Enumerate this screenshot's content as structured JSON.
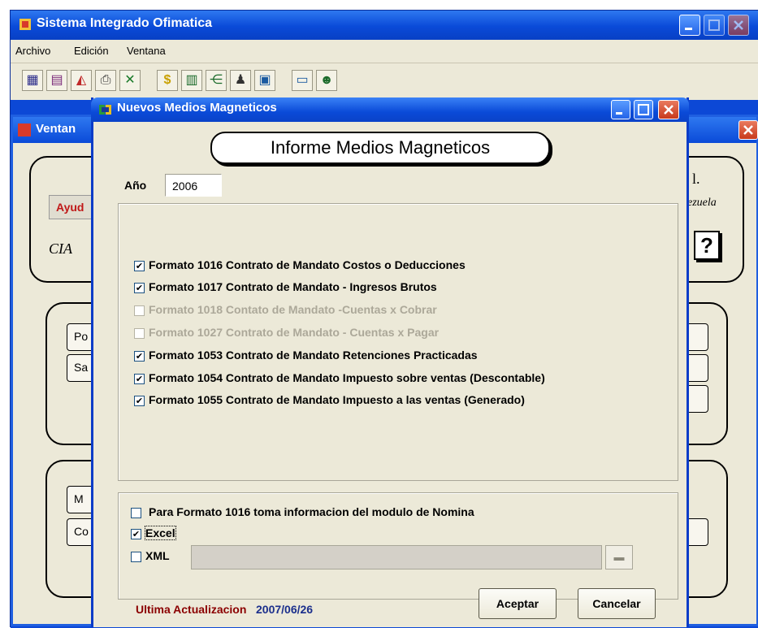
{
  "app": {
    "title": "Sistema Integrado Ofimatica",
    "menu": [
      "Archivo",
      "Edición",
      "Ventana"
    ]
  },
  "toolbar_icons": [
    "calculator-icon",
    "book-icon",
    "chart-icon",
    "printer-icon",
    "excel-icon",
    "dollar-icon",
    "grid-icon",
    "tree-icon",
    "people-icon",
    "window-icon",
    "monitors-icon",
    "user-icon"
  ],
  "background_window": {
    "title": "Ventan",
    "help_label": "Ayud",
    "cia_label": "CIA",
    "right_text_1": "l.",
    "right_text_2": "ezuela",
    "buttons": [
      "Po",
      "Sa",
      "M",
      "Co"
    ]
  },
  "dialog": {
    "title": "Nuevos Medios Magneticos",
    "heading": "Informe Medios Magneticos",
    "year_label": "Año",
    "year_value": "2006",
    "formats": [
      {
        "label": "Formato 1016 Contrato de Mandato Costos o Deducciones",
        "checked": true,
        "enabled": true
      },
      {
        "label": "Formato 1017  Contrato de Mandato - Ingresos Brutos",
        "checked": true,
        "enabled": true
      },
      {
        "label": "Formato 1018 Contato de Mandato -Cuentas x Cobrar",
        "checked": false,
        "enabled": false
      },
      {
        "label": "Formato 1027 Contrato de Mandato - Cuentas x Pagar",
        "checked": false,
        "enabled": false
      },
      {
        "label": "Formato 1053 Contrato de Mandato Retenciones Practicadas",
        "checked": true,
        "enabled": true
      },
      {
        "label": "Formato 1054 Contrato de Mandato Impuesto sobre ventas (Descontable)",
        "checked": true,
        "enabled": true
      },
      {
        "label": "Formato 1055 Contrato de Mandato Impuesto a las ventas (Generado)",
        "checked": true,
        "enabled": true
      }
    ],
    "options": {
      "nomina_label": "Para Formato 1016 toma informacion del modulo de Nomina",
      "nomina_checked": false,
      "excel_label": "Excel",
      "excel_checked": true,
      "xml_label": "XML",
      "xml_checked": false,
      "xml_path": ""
    },
    "updated_label": "Ultima Actualizacion",
    "updated_value": "2007/06/26",
    "accept_label": "Aceptar",
    "cancel_label": "Cancelar"
  },
  "colors": {
    "titlebar_blue": "#0a4ad8",
    "window_face": "#ece9d8",
    "updated_label_red": "#8b0000",
    "updated_value_blue": "#1b2f8c",
    "disabled_text": "#aca899"
  }
}
